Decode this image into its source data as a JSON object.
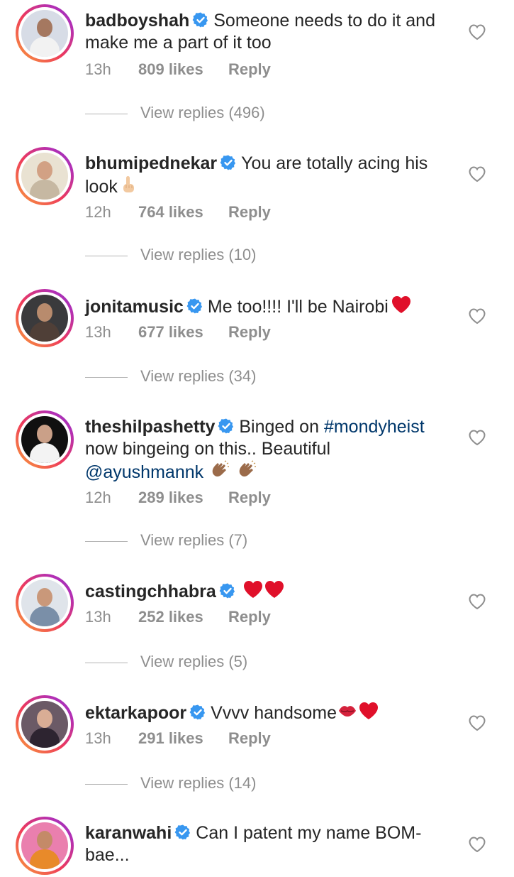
{
  "colors": {
    "verified_blue": "#3897f0",
    "secondary_text": "#8e8e8e",
    "link": "#00376b",
    "heart_red": "#e0102a"
  },
  "comments": [
    {
      "username": "badboyshah",
      "text": "Someone needs to do it and make me a part of it too",
      "emoji": [],
      "time": "13h",
      "likes": "809 likes",
      "reply": "Reply",
      "view_replies": "View replies (496)"
    },
    {
      "username": "bhumipednekar",
      "text": "You are totally acing his look",
      "emoji": [
        "pointing-up-emoji"
      ],
      "time": "12h",
      "likes": "764 likes",
      "reply": "Reply",
      "view_replies": "View replies (10)"
    },
    {
      "username": "jonitamusic",
      "text": "Me too!!!! I'll be Nairobi",
      "emoji": [
        "red-heart-emoji"
      ],
      "time": "13h",
      "likes": "677 likes",
      "reply": "Reply",
      "view_replies": "View replies (34)"
    },
    {
      "username": "theshilpashetty",
      "text_before": "Binged on",
      "hashtag": "#mondyheist",
      "text_middle": "now bingeing on this.. Beautiful",
      "mention": "@ayushmannk",
      "emoji": [
        "clapping-hands-emoji",
        "clapping-hands-emoji"
      ],
      "time": "12h",
      "likes": "289 likes",
      "reply": "Reply",
      "view_replies": "View replies (7)"
    },
    {
      "username": "castingchhabra",
      "text": "",
      "emoji": [
        "red-heart-emoji",
        "red-heart-emoji"
      ],
      "time": "13h",
      "likes": "252 likes",
      "reply": "Reply",
      "view_replies": "View replies (5)"
    },
    {
      "username": "ektarkapoor",
      "text": "Vvvv handsome",
      "emoji": [
        "kiss-mark-emoji",
        "red-heart-emoji"
      ],
      "time": "13h",
      "likes": "291 likes",
      "reply": "Reply",
      "view_replies": "View replies (14)"
    },
    {
      "username": "karanwahi",
      "text": "Can I patent my name BOM-bae...",
      "emoji": []
    }
  ]
}
